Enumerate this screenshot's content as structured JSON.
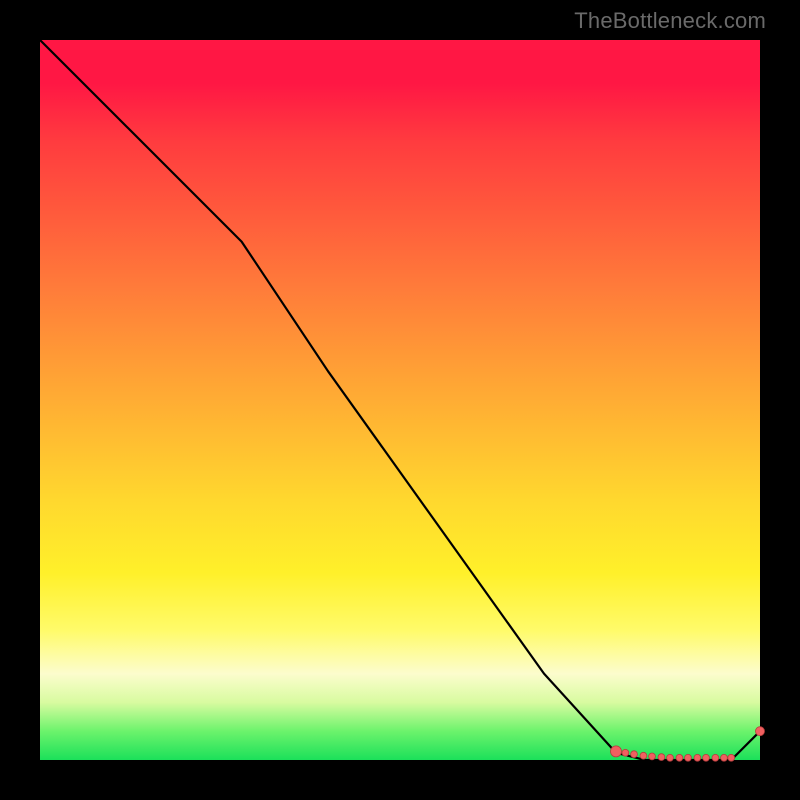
{
  "watermark": "TheBottleneck.com",
  "chart_data": {
    "type": "line",
    "title": "",
    "xlabel": "",
    "ylabel": "",
    "xlim": [
      0,
      100
    ],
    "ylim": [
      0,
      100
    ],
    "grid": false,
    "series": [
      {
        "name": "curve",
        "color": "#000000",
        "x": [
          0,
          10,
          20,
          28,
          40,
          55,
          70,
          80,
          84,
          88,
          92,
          96,
          100
        ],
        "y": [
          100,
          90,
          80,
          72,
          54,
          33,
          12,
          1,
          0,
          0,
          0,
          0,
          4
        ]
      }
    ],
    "markers": {
      "color": "#f06060",
      "stroke": "#b53d3d",
      "points_x": [
        80.0,
        81.3,
        82.5,
        83.8,
        85.0,
        86.3,
        87.5,
        88.8,
        90.0,
        91.3,
        92.5,
        93.8,
        95.0,
        96.0
      ],
      "points_y": [
        1.2,
        1.0,
        0.8,
        0.6,
        0.5,
        0.4,
        0.3,
        0.3,
        0.3,
        0.3,
        0.3,
        0.3,
        0.3,
        0.3
      ],
      "end_point": {
        "x": 100,
        "y": 4
      }
    },
    "background_gradient": {
      "top": "#ff1744",
      "upper_mid": "#ff9a36",
      "mid": "#ffe22e",
      "lower_mid": "#fcfccd",
      "bottom": "#1be05a"
    }
  }
}
